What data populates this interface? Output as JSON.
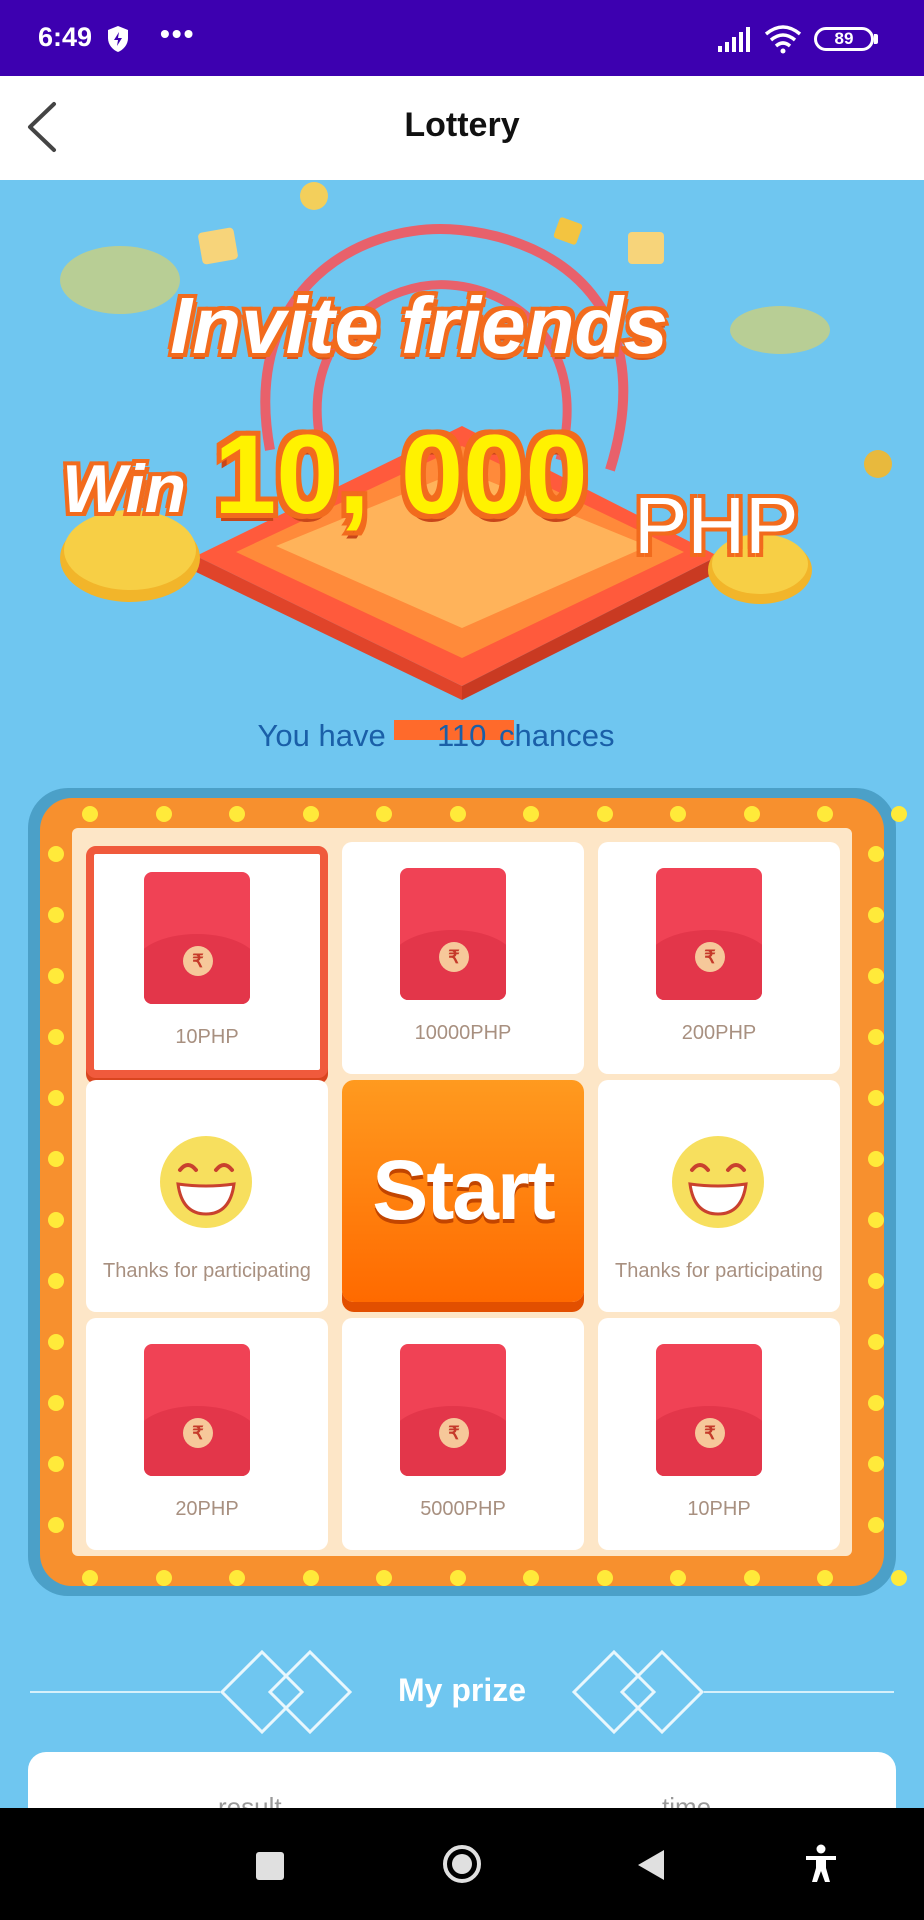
{
  "status_bar": {
    "time": "6:49",
    "battery": "89",
    "icons": [
      "shield-icon",
      "more-dots-icon",
      "signal-icon",
      "wifi-icon",
      "battery-icon"
    ],
    "more": "•••"
  },
  "header": {
    "title": "Lottery",
    "back_icon": "chevron-left-icon"
  },
  "banner": {
    "line1": "Invite friends",
    "win": "Win",
    "amount": "10, 000",
    "currency": "PHP"
  },
  "chances": {
    "prefix": "You have",
    "count": "110",
    "suffix": "chances"
  },
  "grid": {
    "cells": [
      {
        "label": "10PHP",
        "type": "envelope",
        "active": true
      },
      {
        "label": "10000PHP",
        "type": "envelope"
      },
      {
        "label": "200PHP",
        "type": "envelope"
      },
      {
        "label": "Thanks for participating",
        "type": "smiley"
      },
      {
        "label": "Start",
        "type": "button"
      },
      {
        "label": "Thanks for participating",
        "type": "smiley"
      },
      {
        "label": "20PHP",
        "type": "envelope"
      },
      {
        "label": "5000PHP",
        "type": "envelope"
      },
      {
        "label": "10PHP",
        "type": "envelope"
      }
    ],
    "coin_symbol": "₹"
  },
  "prize": {
    "title": "My prize",
    "col_result": "result",
    "col_time": "time"
  },
  "colors": {
    "status_bar": "#3d00b0",
    "background": "#6fc6f0",
    "board": "#f7902e",
    "start": "#ff7a00",
    "envelope": "#f04255"
  }
}
